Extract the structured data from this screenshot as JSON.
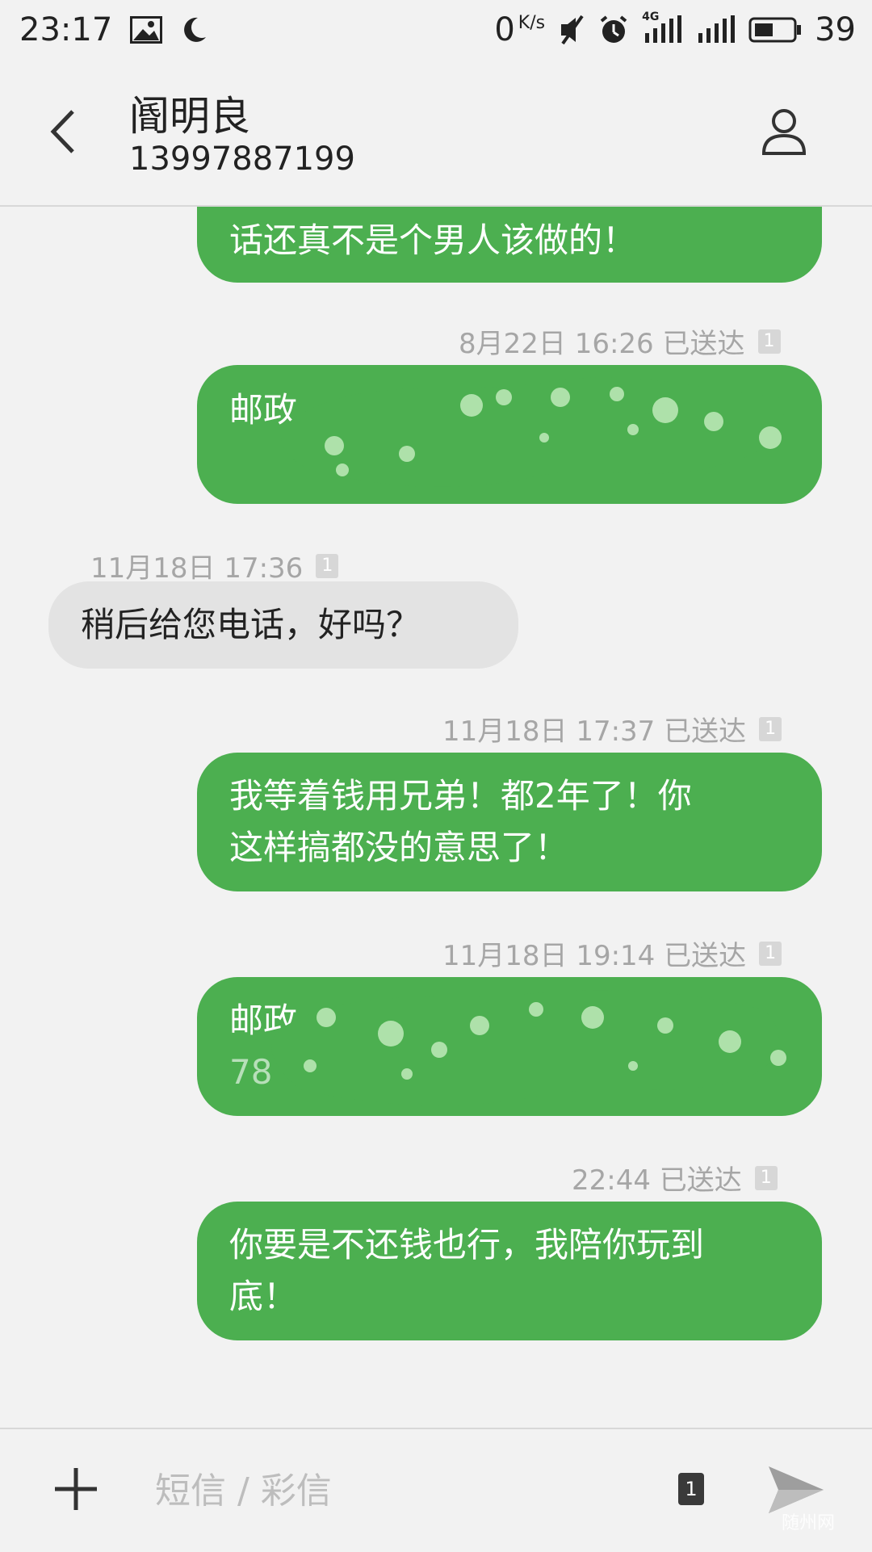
{
  "statusbar": {
    "time": "23:17",
    "net_speed": "0",
    "net_unit": "K/s",
    "network_type": "4G",
    "battery": "39"
  },
  "header": {
    "contact_name": "阍明良",
    "contact_phone": "13997887199"
  },
  "messages": [
    {
      "direction": "out",
      "text": "话还真不是个男人该做的！"
    },
    {
      "meta": "8月22日 16:26  已送达",
      "sim": "1"
    },
    {
      "direction": "out",
      "text": "邮政"
    },
    {
      "meta": "11月18日 17:36",
      "sim": "1"
    },
    {
      "direction": "in",
      "text": "稍后给您电话，好吗？"
    },
    {
      "meta": "11月18日 17:37  已送达",
      "sim": "1"
    },
    {
      "direction": "out",
      "lines": [
        "我等着钱用兄弟！都2年了！你",
        "这样搞都没的意思了！"
      ]
    },
    {
      "meta": "11月18日 19:14  已送达",
      "sim": "1"
    },
    {
      "direction": "out",
      "lines": [
        "邮政",
        "78"
      ]
    },
    {
      "meta": "22:44  已送达",
      "sim": "1"
    },
    {
      "direction": "out",
      "lines": [
        "你要是不还钱也行，我陪你玩到",
        "底！"
      ]
    }
  ],
  "inputbar": {
    "placeholder": "短信 / 彩信",
    "sim": "1"
  },
  "watermark": "随州网",
  "colors": {
    "outgoing_bubble": "#4caf50",
    "incoming_bubble": "#e3e3e3",
    "background": "#f2f2f2",
    "meta_text": "#a6a6a6"
  }
}
